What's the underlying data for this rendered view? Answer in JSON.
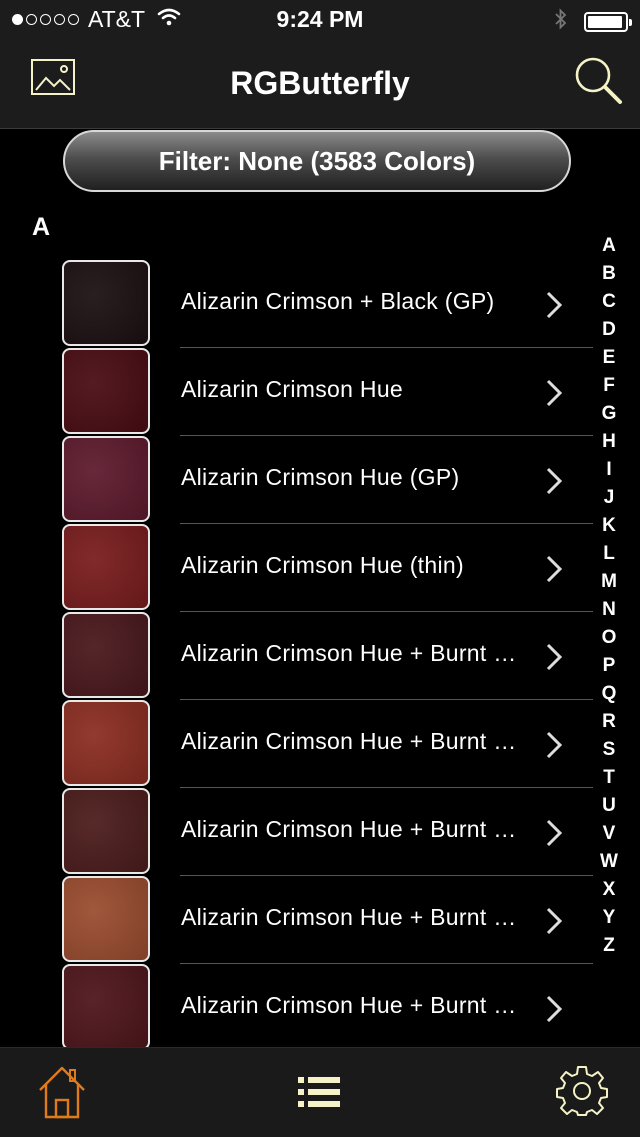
{
  "status_bar": {
    "carrier": "AT&T",
    "time": "9:24 PM",
    "signal_bars_filled": 1,
    "signal_bars_total": 5,
    "battery_level": 0.95,
    "icons": [
      "wifi-icon",
      "bluetooth-icon",
      "battery-icon"
    ]
  },
  "nav": {
    "title": "RGButterfly",
    "left_icon": "image-icon",
    "right_icon": "search-icon"
  },
  "filter": {
    "label": "Filter: None (3583 Colors)"
  },
  "section": {
    "header": "A"
  },
  "list": {
    "items": [
      {
        "label": "Alizarin Crimson + Black (GP)",
        "color": "#1c1012"
      },
      {
        "label": "Alizarin Crimson Hue",
        "color": "#4a0d14"
      },
      {
        "label": "Alizarin Crimson Hue (GP)",
        "color": "#5e1b2e"
      },
      {
        "label": "Alizarin Crimson Hue (thin)",
        "color": "#7a1d1e"
      },
      {
        "label": "Alizarin Crimson Hue + Burnt Umber",
        "color": "#4a181d"
      },
      {
        "label": "Alizarin Crimson Hue + Burnt Sienna",
        "color": "#8c2e22"
      },
      {
        "label": "Alizarin Crimson Hue + Burnt Umber (GP)",
        "color": "#4c1d1c"
      },
      {
        "label": "Alizarin Crimson Hue + Burnt Sienna (thin)",
        "color": "#9b4d30"
      },
      {
        "label": "Alizarin Crimson Hue + Burnt Umber (thin)",
        "color": "#4f161c"
      }
    ]
  },
  "index": {
    "letters": [
      "A",
      "B",
      "C",
      "D",
      "E",
      "F",
      "G",
      "H",
      "I",
      "J",
      "K",
      "L",
      "M",
      "N",
      "O",
      "P",
      "Q",
      "R",
      "S",
      "T",
      "U",
      "V",
      "W",
      "X",
      "Y",
      "Z"
    ]
  },
  "tabs": [
    {
      "name": "home",
      "icon": "home-icon",
      "active": true
    },
    {
      "name": "list",
      "icon": "list-icon",
      "active": false
    },
    {
      "name": "settings",
      "icon": "gear-icon",
      "active": false
    }
  ],
  "colors": {
    "active_tab": "#e07b1a",
    "inactive_tab": "#f4f2c6",
    "search_icon": "#f4f2c6"
  }
}
